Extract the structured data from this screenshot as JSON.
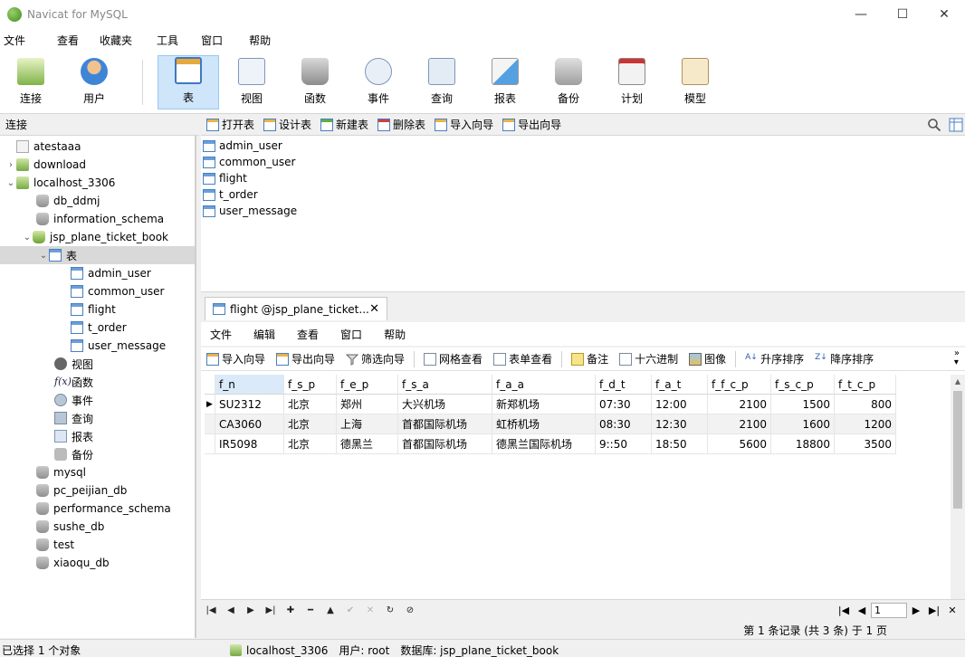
{
  "window": {
    "title": "Navicat for MySQL"
  },
  "menu": [
    "文件",
    "查看",
    "收藏夹",
    "工具",
    "窗口",
    "帮助"
  ],
  "toolbar": [
    {
      "label": "连接",
      "icon": "connection-icon"
    },
    {
      "label": "用户",
      "icon": "user-icon"
    },
    {
      "label": "表",
      "icon": "table-icon",
      "active": true
    },
    {
      "label": "视图",
      "icon": "view-icon"
    },
    {
      "label": "函数",
      "icon": "function-icon"
    },
    {
      "label": "事件",
      "icon": "event-icon"
    },
    {
      "label": "查询",
      "icon": "query-icon"
    },
    {
      "label": "报表",
      "icon": "report-icon"
    },
    {
      "label": "备份",
      "icon": "backup-icon"
    },
    {
      "label": "计划",
      "icon": "schedule-icon"
    },
    {
      "label": "模型",
      "icon": "model-icon"
    }
  ],
  "sidebar": {
    "header": "连接",
    "items": [
      {
        "label": "atestaaa",
        "icon": "connection-icon",
        "arrow": ""
      },
      {
        "label": "download",
        "icon": "connection-icon",
        "arrow": "›"
      },
      {
        "label": "localhost_3306",
        "icon": "connection-icon",
        "arrow": "⌄"
      },
      {
        "label": "db_ddmj",
        "icon": "database-icon",
        "arrow": ""
      },
      {
        "label": "information_schema",
        "icon": "database-icon",
        "arrow": ""
      },
      {
        "label": "jsp_plane_ticket_book",
        "icon": "database-open-icon",
        "arrow": "⌄"
      },
      {
        "label": "表",
        "icon": "tables-folder-icon",
        "arrow": "⌄",
        "selected": true
      },
      {
        "label": "admin_user",
        "icon": "table-icon",
        "arrow": ""
      },
      {
        "label": "common_user",
        "icon": "table-icon",
        "arrow": ""
      },
      {
        "label": "flight",
        "icon": "table-icon",
        "arrow": ""
      },
      {
        "label": "t_order",
        "icon": "table-icon",
        "arrow": ""
      },
      {
        "label": "user_message",
        "icon": "table-icon",
        "arrow": ""
      },
      {
        "label": "视图",
        "icon": "view-icon",
        "arrow": ""
      },
      {
        "label": "函数",
        "icon": "function-icon",
        "arrow": ""
      },
      {
        "label": "事件",
        "icon": "event-icon",
        "arrow": ""
      },
      {
        "label": "查询",
        "icon": "query-icon",
        "arrow": ""
      },
      {
        "label": "报表",
        "icon": "report-icon",
        "arrow": ""
      },
      {
        "label": "备份",
        "icon": "backup-icon",
        "arrow": ""
      },
      {
        "label": "mysql",
        "icon": "database-icon",
        "arrow": ""
      },
      {
        "label": "pc_peijian_db",
        "icon": "database-icon",
        "arrow": ""
      },
      {
        "label": "performance_schema",
        "icon": "database-icon",
        "arrow": ""
      },
      {
        "label": "sushe_db",
        "icon": "database-icon",
        "arrow": ""
      },
      {
        "label": "test",
        "icon": "database-icon",
        "arrow": ""
      },
      {
        "label": "xiaoqu_db",
        "icon": "database-icon",
        "arrow": ""
      }
    ]
  },
  "object_toolbar": [
    "打开表",
    "设计表",
    "新建表",
    "删除表",
    "导入向导",
    "导出向导"
  ],
  "object_list": [
    "admin_user",
    "common_user",
    "flight",
    "t_order",
    "user_message"
  ],
  "tab": {
    "label": "flight @jsp_plane_ticket...",
    "close": "✕"
  },
  "inner_menu": [
    "文件",
    "编辑",
    "查看",
    "窗口",
    "帮助"
  ],
  "grid_toolbar": [
    "导入向导",
    "导出向导",
    "筛选向导",
    "网格查看",
    "表单查看",
    "备注",
    "十六进制",
    "图像",
    "升序排序",
    "降序排序"
  ],
  "grid": {
    "columns": [
      "f_n",
      "f_s_p",
      "f_e_p",
      "f_s_a",
      "f_a_a",
      "f_d_t",
      "f_a_t",
      "f_f_c_p",
      "f_s_c_p",
      "f_t_c_p"
    ],
    "rows": [
      [
        "SU2312",
        "北京",
        "郑州",
        "大兴机场",
        "新郑机场",
        "07:30",
        "12:00",
        "2100",
        "1500",
        "800"
      ],
      [
        "CA3060",
        "北京",
        "上海",
        "首都国际机场",
        "虹桥机场",
        "08:30",
        "12:30",
        "2100",
        "1600",
        "1200"
      ],
      [
        "IR5098",
        "北京",
        "德黑兰",
        "首都国际机场",
        "德黑兰国际机场",
        "9::50",
        "18:50",
        "5600",
        "18800",
        "3500"
      ]
    ]
  },
  "pager": {
    "page": "1"
  },
  "record_info": "第 1 条记录 (共 3 条) 于 1 页",
  "status": {
    "selection": "已选择 1 个对象",
    "connection": "localhost_3306",
    "user": "用户: root",
    "database": "数据库: jsp_plane_ticket_book"
  }
}
